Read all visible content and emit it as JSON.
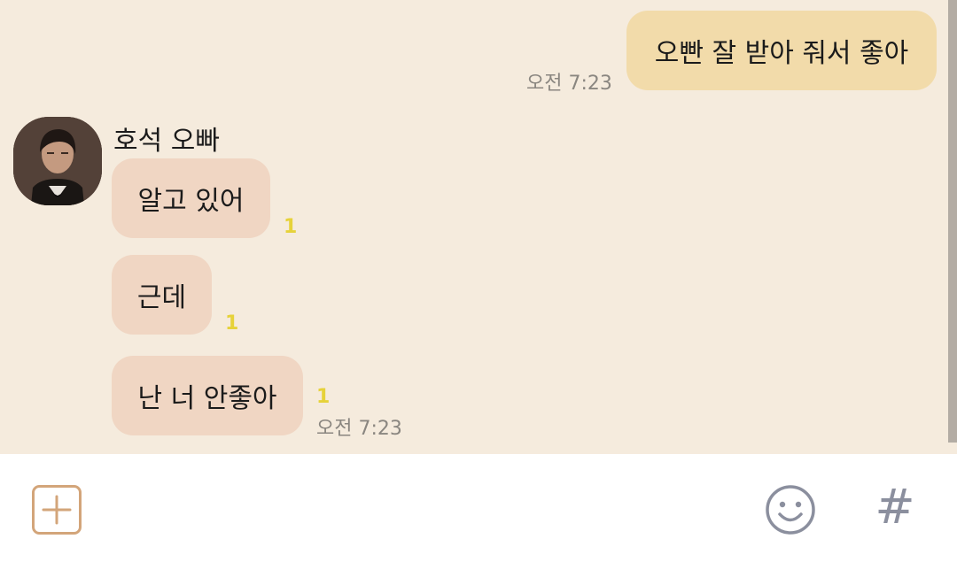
{
  "messages": [
    {
      "direction": "sent",
      "text": "오빤 잘 받아 줘서 좋아",
      "time": "오전 7:23"
    },
    {
      "direction": "received",
      "text": "알고 있어",
      "unread": "1"
    },
    {
      "direction": "received",
      "text": "근데",
      "unread": "1"
    },
    {
      "direction": "received",
      "text": "난 너 안좋아",
      "unread": "1",
      "time": "오전 7:23"
    }
  ],
  "sender": {
    "name": "호석 오빠"
  },
  "input_bar": {
    "hash_symbol": "#",
    "icons": [
      "plus-square-icon",
      "emoji-smile-icon",
      "hashtag-icon"
    ]
  },
  "colors": {
    "chat_background": "#f5ebdd",
    "sent_bubble": "#f2dbaa",
    "received_bubble": "#f0d6c3",
    "unread_count": "#e6d23a",
    "timestamp": "#8a8680",
    "plus_button": "#d3a57a",
    "input_icons": "#8b8f9e"
  }
}
